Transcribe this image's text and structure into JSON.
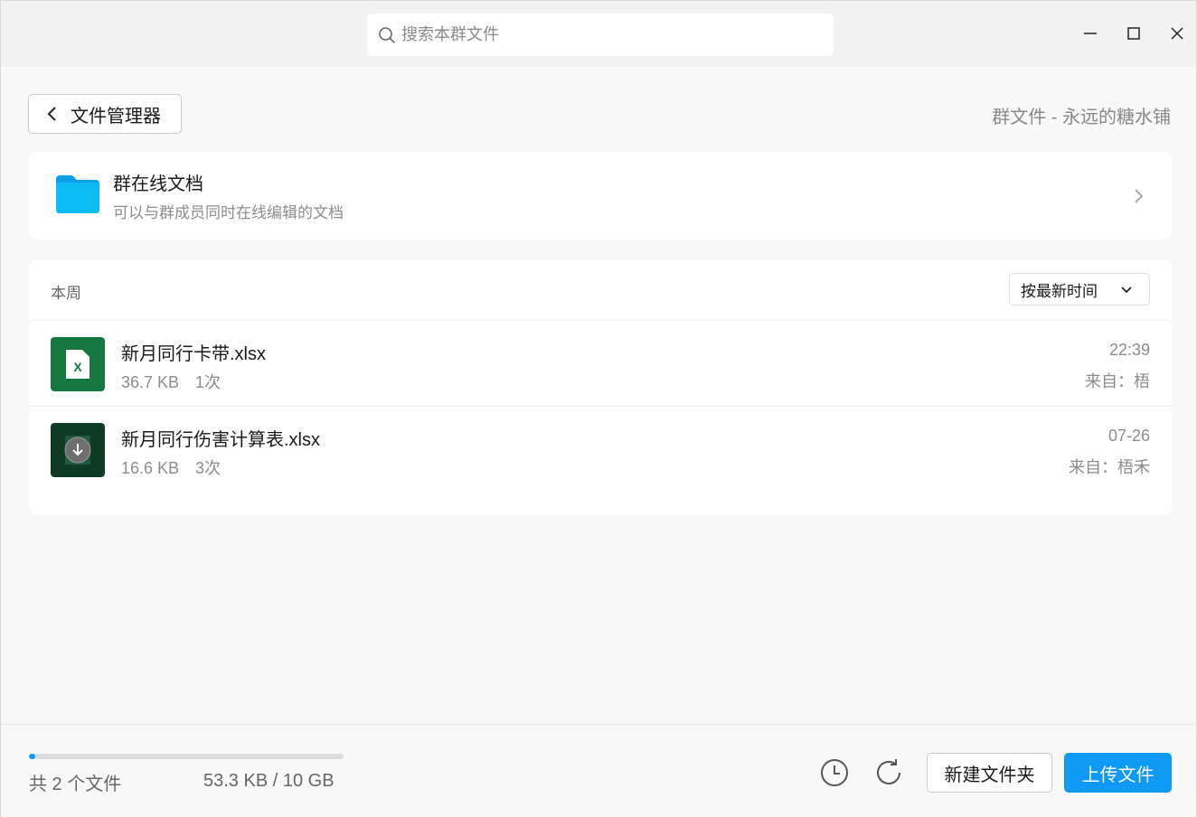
{
  "search": {
    "placeholder": "搜索本群文件"
  },
  "header": {
    "back_label": "文件管理器",
    "group_title": "群文件 - 永远的糖水铺"
  },
  "online_docs": {
    "title": "群在线文档",
    "subtitle": "可以与群成员同时在线编辑的文档"
  },
  "file_list": {
    "section_label": "本周",
    "sort_label": "按最新时间",
    "files": [
      {
        "name": "新月同行卡带.xlsx",
        "size": "36.7 KB",
        "downloads": "1次",
        "time": "22:39",
        "from": "来自：梧",
        "icon": "excel-file-icon"
      },
      {
        "name": "新月同行伤害计算表.xlsx",
        "size": "16.6 KB",
        "downloads": "3次",
        "time": "07-26",
        "from": "来自：梧禾",
        "icon": "download-file-icon"
      }
    ]
  },
  "footer": {
    "file_count": "共 2 个文件",
    "storage": "53.3 KB / 10 GB",
    "storage_used_fraction": 0.02,
    "new_folder_label": "新建文件夹",
    "upload_label": "上传文件"
  },
  "colors": {
    "accent": "#0f99f6",
    "folder": "#0dbcf5",
    "excel": "#17783f",
    "dark_file": "#0f3b25"
  }
}
